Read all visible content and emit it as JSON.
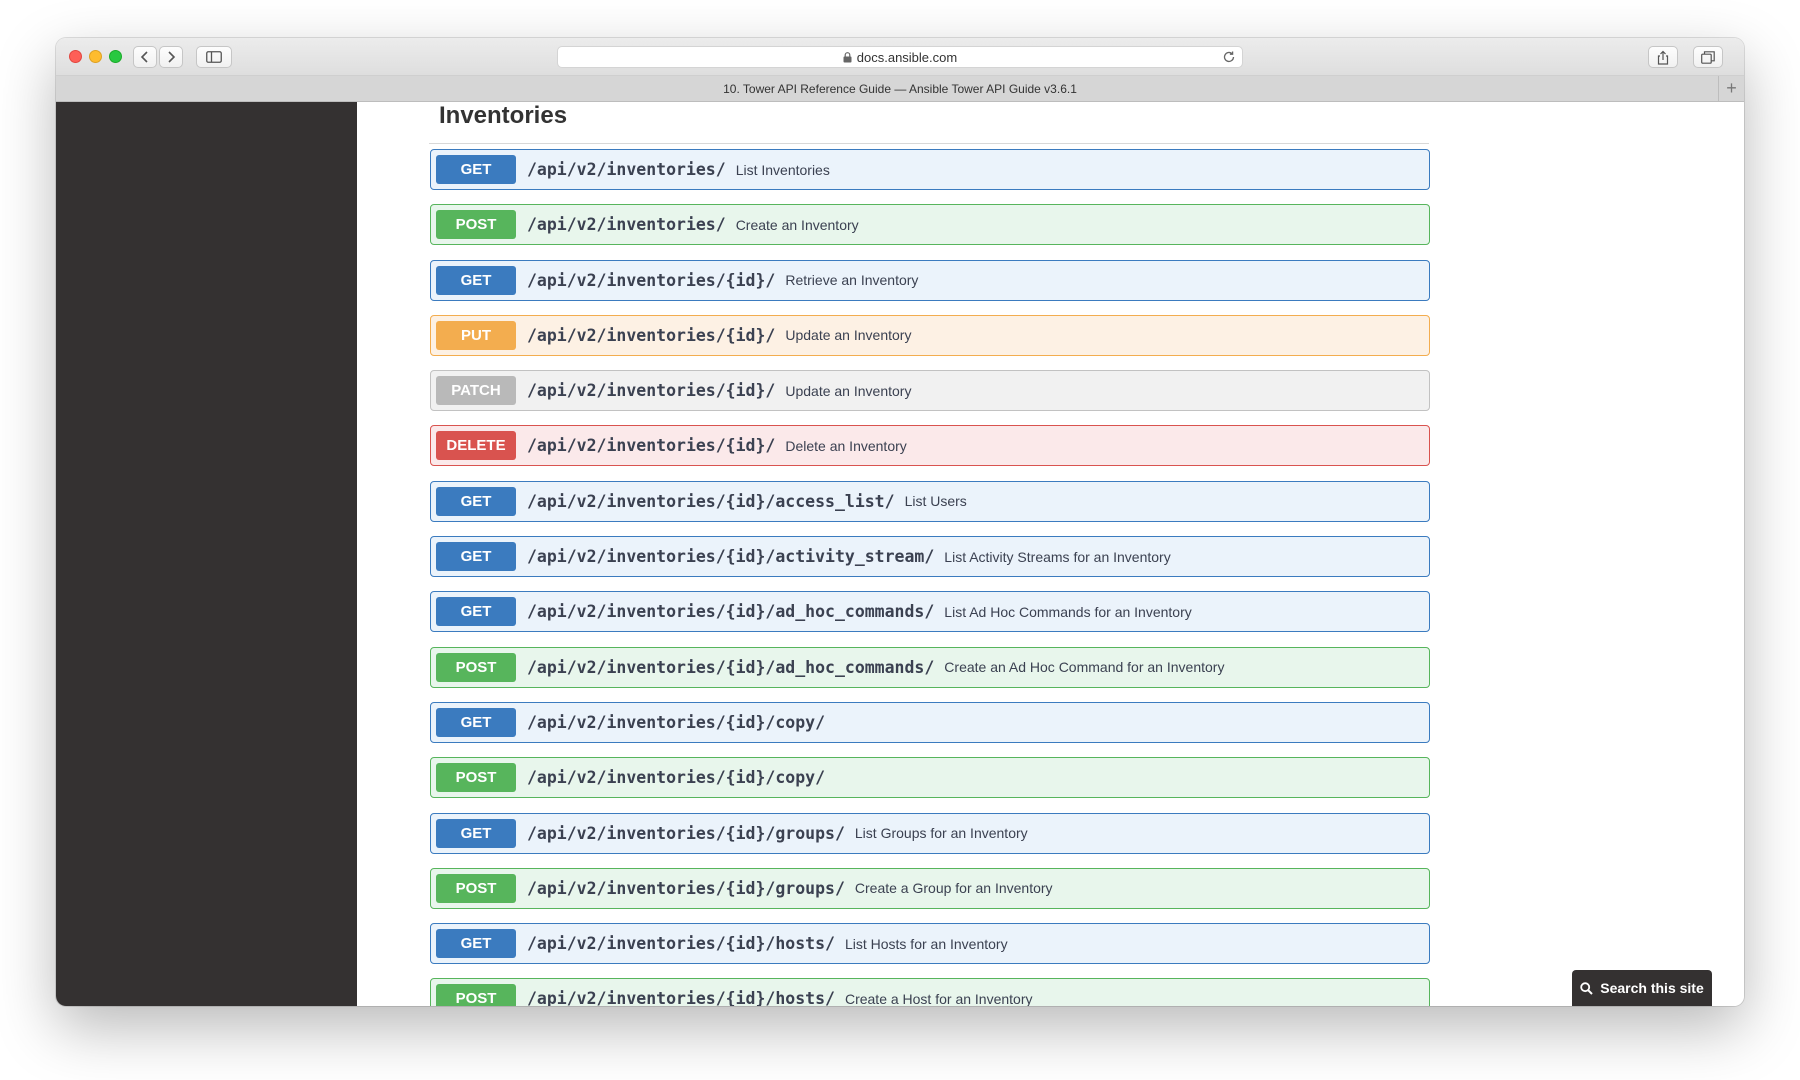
{
  "browser": {
    "url": "docs.ansible.com",
    "tab_title": "10. Tower API Reference Guide — Ansible Tower API Guide v3.6.1",
    "new_tab_label": "+"
  },
  "page": {
    "title": "Inventories",
    "search_button": "Search this site"
  },
  "method_colors": {
    "GET": "#3b7bbf",
    "POST": "#57b55c",
    "PUT": "#f3ad4f",
    "PATCH": "#b9b9b9",
    "DELETE": "#d9534f"
  },
  "operations": [
    {
      "method": "GET",
      "path": "/api/v2/inventories/",
      "summary": "List Inventories"
    },
    {
      "method": "POST",
      "path": "/api/v2/inventories/",
      "summary": "Create an Inventory"
    },
    {
      "method": "GET",
      "path": "/api/v2/inventories/{id}/",
      "summary": "Retrieve an Inventory"
    },
    {
      "method": "PUT",
      "path": "/api/v2/inventories/{id}/",
      "summary": "Update an Inventory"
    },
    {
      "method": "PATCH",
      "path": "/api/v2/inventories/{id}/",
      "summary": "Update an Inventory"
    },
    {
      "method": "DELETE",
      "path": "/api/v2/inventories/{id}/",
      "summary": "Delete an Inventory"
    },
    {
      "method": "GET",
      "path": "/api/v2/inventories/{id}/access_list/",
      "summary": "List Users"
    },
    {
      "method": "GET",
      "path": "/api/v2/inventories/{id}/activity_stream/",
      "summary": "List Activity Streams for an Inventory"
    },
    {
      "method": "GET",
      "path": "/api/v2/inventories/{id}/ad_hoc_commands/",
      "summary": "List Ad Hoc Commands for an Inventory"
    },
    {
      "method": "POST",
      "path": "/api/v2/inventories/{id}/ad_hoc_commands/",
      "summary": "Create an Ad Hoc Command for an Inventory"
    },
    {
      "method": "GET",
      "path": "/api/v2/inventories/{id}/copy/",
      "summary": ""
    },
    {
      "method": "POST",
      "path": "/api/v2/inventories/{id}/copy/",
      "summary": ""
    },
    {
      "method": "GET",
      "path": "/api/v2/inventories/{id}/groups/",
      "summary": "List Groups for an Inventory"
    },
    {
      "method": "POST",
      "path": "/api/v2/inventories/{id}/groups/",
      "summary": "Create a Group for an Inventory"
    },
    {
      "method": "GET",
      "path": "/api/v2/inventories/{id}/hosts/",
      "summary": "List Hosts for an Inventory"
    },
    {
      "method": "POST",
      "path": "/api/v2/inventories/{id}/hosts/",
      "summary": "Create a Host for an Inventory"
    }
  ]
}
